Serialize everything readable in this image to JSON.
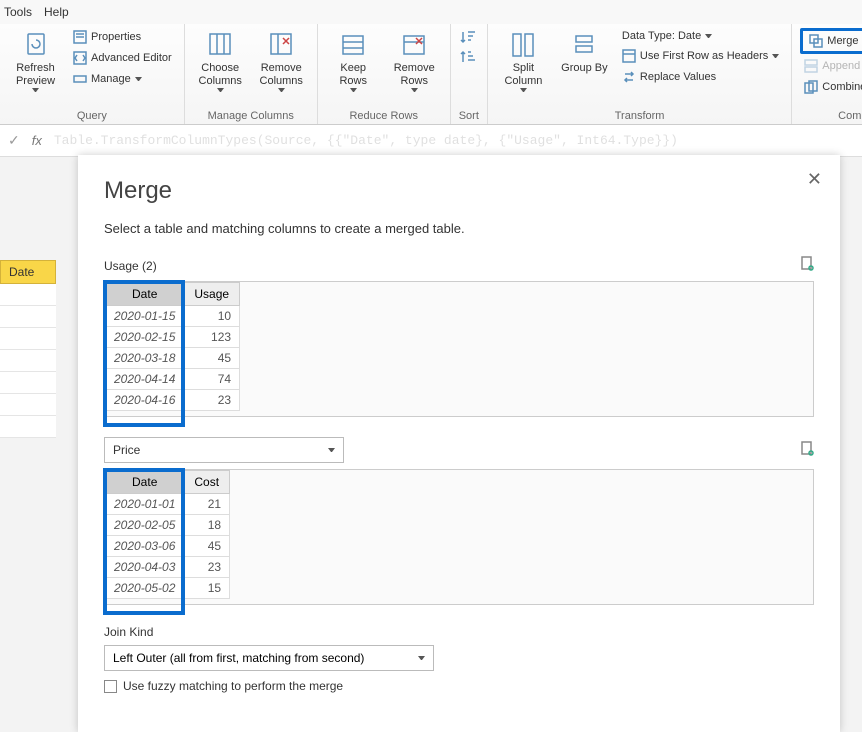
{
  "menu": {
    "tools": "Tools",
    "help": "Help"
  },
  "ribbon": {
    "refresh": "Refresh Preview",
    "properties": "Properties",
    "advanced_editor": "Advanced Editor",
    "manage": "Manage",
    "choose_cols": "Choose Columns",
    "remove_cols": "Remove Columns",
    "keep_rows": "Keep Rows",
    "remove_rows": "Remove Rows",
    "sort": "Sort",
    "split_col": "Split Column",
    "group_by": "Group By",
    "data_type": "Data Type: Date",
    "first_row_headers": "Use First Row as Headers",
    "replace_values": "Replace Values",
    "merge_queries": "Merge Queries",
    "append_queries": "Append Queries",
    "combine_files": "Combine Files",
    "g_query": "Query",
    "g_manage_cols": "Manage Columns",
    "g_reduce_rows": "Reduce Rows",
    "g_sort": "Sort",
    "g_transform": "Transform",
    "g_combine": "Combine"
  },
  "left": {
    "date_pill": "Date"
  },
  "dialog": {
    "title": "Merge",
    "subtitle": "Select a table and matching columns to create a merged table.",
    "table1_label": "Usage (2)",
    "table1": {
      "headers": [
        "Date",
        "Usage"
      ],
      "rows": [
        [
          "2020-01-15",
          "10"
        ],
        [
          "2020-02-15",
          "123"
        ],
        [
          "2020-03-18",
          "45"
        ],
        [
          "2020-04-14",
          "74"
        ],
        [
          "2020-04-16",
          "23"
        ]
      ]
    },
    "table2_select": "Price",
    "table2": {
      "headers": [
        "Date",
        "Cost"
      ],
      "rows": [
        [
          "2020-01-01",
          "21"
        ],
        [
          "2020-02-05",
          "18"
        ],
        [
          "2020-03-06",
          "45"
        ],
        [
          "2020-04-03",
          "23"
        ],
        [
          "2020-05-02",
          "15"
        ]
      ]
    },
    "join_kind_label": "Join Kind",
    "join_kind": "Left Outer (all from first, matching from second)",
    "fuzzy": "Use fuzzy matching to perform the merge"
  }
}
